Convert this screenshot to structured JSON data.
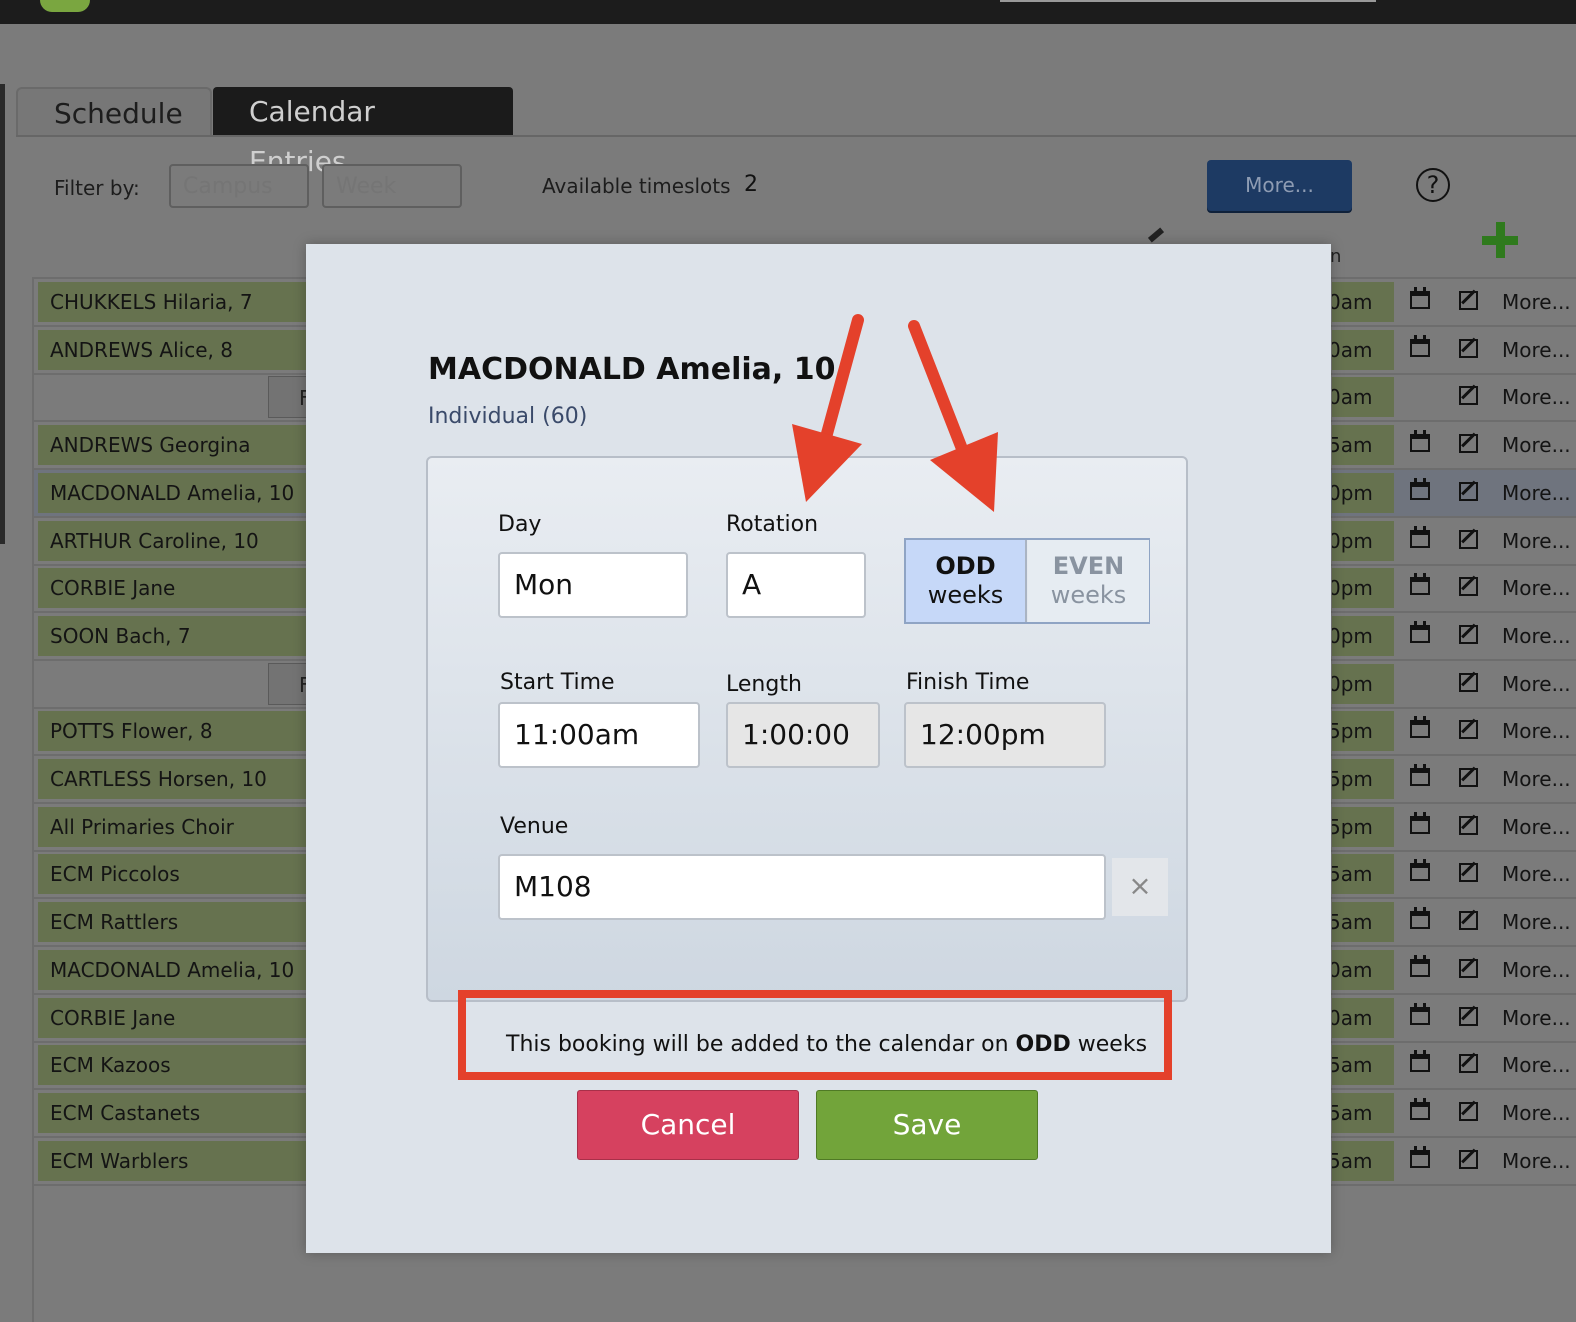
{
  "tabs": {
    "schedule": "Schedule",
    "calendar": "Calendar Entries"
  },
  "filter": {
    "label": "Filter by:",
    "campus_placeholder": "Campus",
    "week_placeholder": "Week",
    "available_label": "Available timeslots",
    "available_count": "2",
    "more_button": "More...",
    "help_glyph": "?"
  },
  "header_fragment": "n",
  "rows": [
    {
      "name": "CHUKKELS Hilaria, 7",
      "time": "0am",
      "cal": true
    },
    {
      "name": "ANDREWS Alice, 8",
      "time": "0am",
      "cal": true
    },
    {
      "name": "",
      "sep": "F",
      "time": "0am",
      "cal": false
    },
    {
      "name": "ANDREWS Georgina",
      "time": "5am",
      "cal": true
    },
    {
      "name": "MACDONALD Amelia, 10",
      "time": "0pm",
      "cal": true
    },
    {
      "name": "ARTHUR Caroline, 10",
      "time": "0pm",
      "cal": true
    },
    {
      "name": "CORBIE Jane",
      "time": "0pm",
      "cal": true
    },
    {
      "name": "SOON Bach, 7",
      "time": "0pm",
      "cal": true
    },
    {
      "name": "",
      "sep": "F",
      "time": "0pm",
      "cal": false
    },
    {
      "name": "POTTS Flower, 8",
      "time": "5pm",
      "cal": true
    },
    {
      "name": "CARTLESS Horsen, 10",
      "time": "5pm",
      "cal": true
    },
    {
      "name": "All Primaries Choir",
      "time": "5pm",
      "cal": true
    },
    {
      "name": "ECM Piccolos",
      "time": "5am",
      "cal": true
    },
    {
      "name": "ECM Rattlers",
      "time": "5am",
      "cal": true
    },
    {
      "name": "MACDONALD Amelia, 10",
      "time": "0am",
      "cal": true
    },
    {
      "name": "CORBIE Jane",
      "time": "0am",
      "cal": true
    },
    {
      "name": "ECM Kazoos",
      "time": "5am",
      "cal": true
    },
    {
      "name": "ECM Castanets",
      "time": "5am",
      "cal": true
    },
    {
      "name": "ECM Warblers",
      "time": "5am",
      "cal": true
    }
  ],
  "row_more_label": "More...",
  "modal": {
    "title": "MACDONALD Amelia, 10",
    "subtitle": "Individual (60)",
    "day_label": "Day",
    "day_value": "Mon",
    "rotation_label": "Rotation",
    "rotation_value": "A",
    "odd_bold": "ODD",
    "odd_sub": "weeks",
    "even_bold": "EVEN",
    "even_sub": "weeks",
    "start_label": "Start Time",
    "start_value": "11:00am",
    "length_label": "Length",
    "length_value": "1:00:00",
    "finish_label": "Finish Time",
    "finish_value": "12:00pm",
    "venue_label": "Venue",
    "venue_value": "M108",
    "clear_glyph": "×",
    "notice_prefix": "This booking will be added to the calendar on",
    "notice_bold": "ODD",
    "notice_suffix": "weeks",
    "cancel": "Cancel",
    "save": "Save"
  },
  "colors": {
    "annotation_red": "#e4412b",
    "odd_selected": "#c6d8f8",
    "cancel": "#d6415f",
    "save": "#72a43a",
    "more_button": "#1d3a63"
  }
}
